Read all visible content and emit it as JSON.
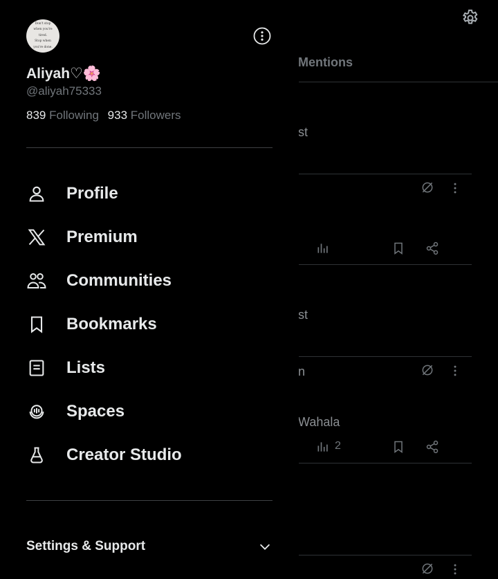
{
  "profile": {
    "avatar_text": "Don't stop\nwhen you're\ntired.\nStop when\nyou're done.",
    "name": "Aliyah♡🌸",
    "handle": "@aliyah75333",
    "following_count": "839",
    "following_label": "Following",
    "followers_count": "933",
    "followers_label": "Followers"
  },
  "menu": {
    "profile": "Profile",
    "premium": "Premium",
    "communities": "Communities",
    "bookmarks": "Bookmarks",
    "lists": "Lists",
    "spaces": "Spaces",
    "creator_studio": "Creator Studio"
  },
  "settings_support": "Settings & Support",
  "background": {
    "tab_label": "Mentions",
    "snippet_1": "st",
    "snippet_2": "st",
    "snippet_3": "n",
    "snippet_4": "Wahala",
    "view_count": "2"
  },
  "icons": {
    "more": "more-options-icon",
    "gear": "gear-icon",
    "profile": "person-icon",
    "premium": "x-logo-icon",
    "communities": "people-icon",
    "bookmarks": "bookmark-icon",
    "lists": "list-icon",
    "spaces": "microphone-icon",
    "creator_studio": "flask-icon",
    "chevron": "chevron-down-icon"
  },
  "colors": {
    "background": "#000000",
    "text_primary": "#e7e9ea",
    "text_secondary": "#71767b",
    "divider": "#2f3336"
  }
}
